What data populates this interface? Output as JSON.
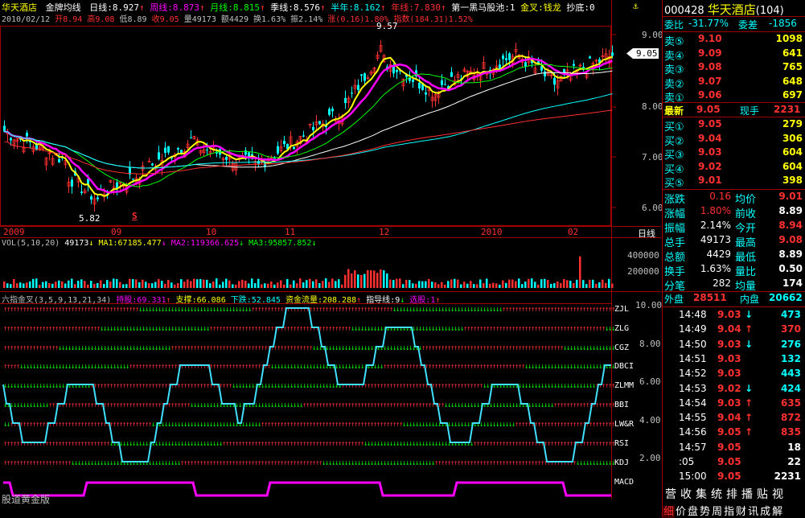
{
  "header": {
    "name": "华天酒店",
    "indicator": "金牌均线",
    "ma": [
      {
        "label": "日线:8.927",
        "color": "#ffffff"
      },
      {
        "label": "周线:8.873",
        "color": "#ff00ff"
      },
      {
        "label": "月线:8.815",
        "color": "#00ff00"
      },
      {
        "label": "季线:8.576",
        "color": "#ffffff"
      },
      {
        "label": "半年:8.162",
        "color": "#00ffff"
      },
      {
        "label": "年线:7.830",
        "color": "#ff3030"
      }
    ],
    "extra1": "第一黑马股池:1",
    "extra2": "金叉:钱龙",
    "extra3": "抄底:0",
    "date": "2010/02/12",
    "open": "开8.94",
    "high": "高9.08",
    "low": "低8.89",
    "close": "收9.05",
    "vol": "量49173",
    "amount": "额4429",
    "turnover": "换1.63%",
    "amp": "振2.14%",
    "chg": "涨(0.16)1.80%",
    "index": "指数(184.31)1.52%"
  },
  "price_panel": {
    "y_ticks": [
      "9.00",
      "8.00",
      "7.00",
      "6.00"
    ],
    "current_price": "9.05",
    "high_label": "9.57",
    "low_label": "5.82",
    "marker": "S",
    "x_labels": [
      "2009",
      "09",
      "10",
      "11",
      "12",
      "2010",
      "02"
    ],
    "period": "日线"
  },
  "volume_panel": {
    "title": "VOL(5,10,20)",
    "vol": "49173",
    "ma1": "MA1:67185.477",
    "ma2": "MA2:119366.625",
    "ma3": "MA3:95857.852",
    "y_ticks": [
      "400000",
      "200000"
    ]
  },
  "signal_panel": {
    "title": "六指金叉(3,5,9,13,21,34)",
    "hold": "持股:69.331",
    "support": "支撑:66.086",
    "down": "下跌:52.845",
    "fund": "资金流量:208.288",
    "guide": "指导线:9",
    "pick": "选股:1",
    "rows": [
      "ZJL",
      "ZLG",
      "CGZ",
      "DBCI",
      "ZLMM",
      "BBI",
      "LW&R",
      "RSI",
      "KDJ",
      "MACD"
    ],
    "y_ticks": [
      "10.00",
      "8.00",
      "6.00",
      "4.00",
      "2.00"
    ],
    "footer": "股道黄金版"
  },
  "quote": {
    "code": "000428",
    "name": "华天酒店",
    "number": "(104)",
    "weibi_label": "委比",
    "weibi": "-31.77%",
    "weicha_label": "委差",
    "weicha": "-1856",
    "asks": [
      {
        "label": "卖⑤",
        "price": "9.10",
        "vol": "1098"
      },
      {
        "label": "卖④",
        "price": "9.09",
        "vol": "641"
      },
      {
        "label": "卖③",
        "price": "9.08",
        "vol": "765"
      },
      {
        "label": "卖②",
        "price": "9.07",
        "vol": "648"
      },
      {
        "label": "卖①",
        "price": "9.06",
        "vol": "697"
      }
    ],
    "latest_label": "最新",
    "latest": "9.05",
    "cur_label": "现手",
    "cur_vol": "2231",
    "bids": [
      {
        "label": "买①",
        "price": "9.05",
        "vol": "279"
      },
      {
        "label": "买②",
        "price": "9.04",
        "vol": "306"
      },
      {
        "label": "买③",
        "price": "9.03",
        "vol": "604"
      },
      {
        "label": "买④",
        "price": "9.02",
        "vol": "604"
      },
      {
        "label": "买⑤",
        "price": "9.01",
        "vol": "398"
      }
    ],
    "stats": [
      {
        "l1": "涨跌",
        "v1": "0.16",
        "c1": "#ff3030",
        "l2": "均价",
        "v2": "9.01",
        "c2": "#ff3030"
      },
      {
        "l1": "涨幅",
        "v1": "1.80%",
        "c1": "#ff3030",
        "l2": "前收",
        "v2": "8.89",
        "c2": "#ffffff"
      },
      {
        "l1": "振幅",
        "v1": "2.14%",
        "c1": "#ffffff",
        "l2": "今开",
        "v2": "8.94",
        "c2": "#ff3030"
      },
      {
        "l1": "总手",
        "v1": "49173",
        "c1": "#ffffff",
        "l2": "最高",
        "v2": "9.08",
        "c2": "#ff3030"
      },
      {
        "l1": "总额",
        "v1": "4429",
        "c1": "#ffffff",
        "l2": "最低",
        "v2": "8.89",
        "c2": "#ffffff"
      },
      {
        "l1": "换手",
        "v1": "1.63%",
        "c1": "#ffffff",
        "l2": "量比",
        "v2": "0.50",
        "c2": "#ffffff"
      },
      {
        "l1": "分笔",
        "v1": "282",
        "c1": "#ffffff",
        "l2": "均量",
        "v2": "174",
        "c2": "#ffffff"
      }
    ],
    "outer_label": "外盘",
    "outer": "28511",
    "inner_label": "内盘",
    "inner": "20662",
    "ticks": [
      {
        "time": "14:48",
        "price": "9.03",
        "dir": "↓",
        "vol": "473",
        "color": "#00ffff"
      },
      {
        "time": "14:49",
        "price": "9.04",
        "dir": "↑",
        "vol": "370",
        "color": "#ff3030"
      },
      {
        "time": "14:50",
        "price": "9.03",
        "dir": "↓",
        "vol": "276",
        "color": "#00ffff"
      },
      {
        "time": "14:51",
        "price": "9.03",
        "dir": "",
        "vol": "132",
        "color": "#00ffff"
      },
      {
        "time": "14:52",
        "price": "9.03",
        "dir": "",
        "vol": "443",
        "color": "#00ffff"
      },
      {
        "time": "14:53",
        "price": "9.02",
        "dir": "↓",
        "vol": "424",
        "color": "#00ffff"
      },
      {
        "time": "14:54",
        "price": "9.03",
        "dir": "↑",
        "vol": "635",
        "color": "#ff3030"
      },
      {
        "time": "14:55",
        "price": "9.04",
        "dir": "↑",
        "vol": "872",
        "color": "#ff3030"
      },
      {
        "time": "14:56",
        "price": "9.05",
        "dir": "↑",
        "vol": "835",
        "color": "#ff3030"
      },
      {
        "time": "14:57",
        "price": "9.05",
        "dir": "",
        "vol": "18",
        "color": "#ffffff"
      },
      {
        "time": ":05",
        "price": "9.05",
        "dir": "",
        "vol": "22",
        "color": "#ffffff"
      },
      {
        "time": "15:00",
        "price": "9.05",
        "dir": "",
        "vol": "2231",
        "color": "#ffffff"
      }
    ],
    "tabs1": [
      "营",
      "收",
      "集",
      "统",
      "排",
      "播",
      "贴",
      "视"
    ],
    "tabs2": [
      "细",
      "价",
      "盘",
      "势",
      "周",
      "指",
      "财",
      "讯",
      "成",
      "解"
    ]
  },
  "colors": {
    "up": "#ff3030",
    "down": "#00ffff",
    "frame": "#a00000",
    "yellow": "#ffff00",
    "magenta": "#ff00ff"
  }
}
